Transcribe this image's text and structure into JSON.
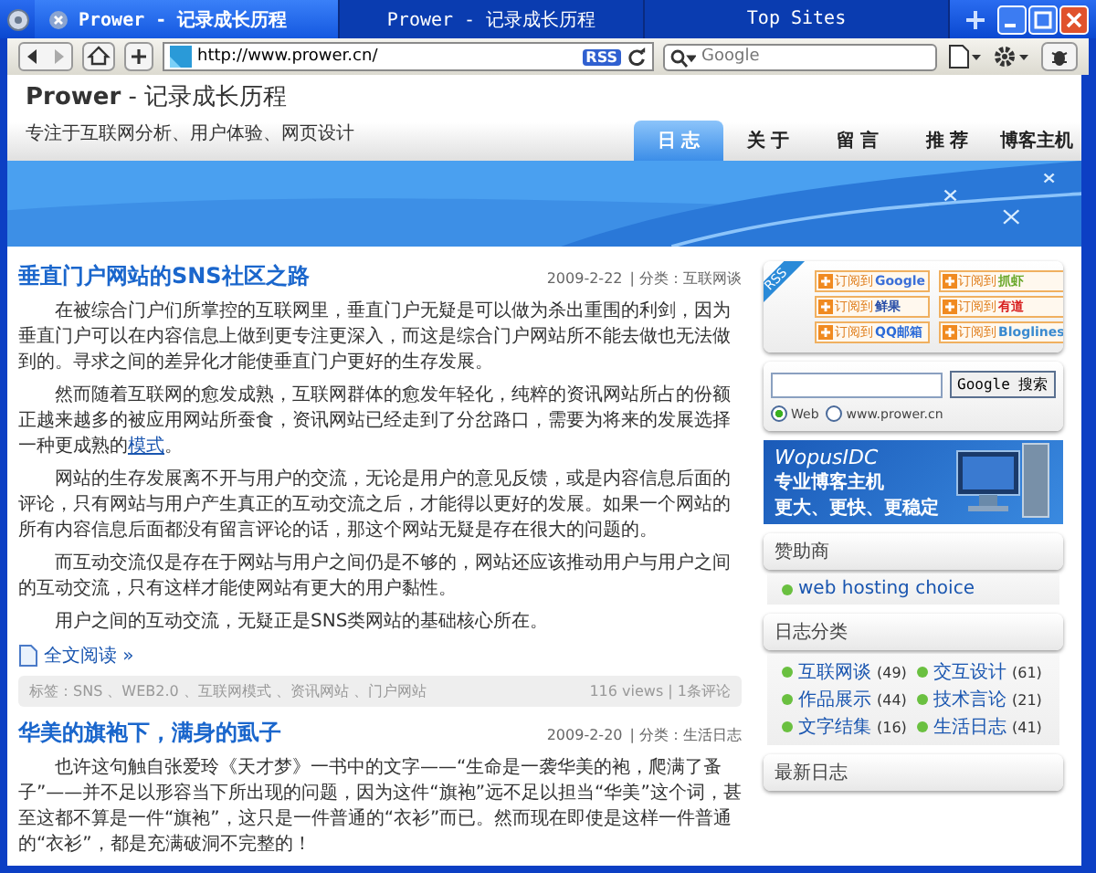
{
  "browser": {
    "tabs": [
      {
        "label": "Prower - 记录成长历程",
        "selected": true
      },
      {
        "label": "Prower - 记录成长历程",
        "selected": false
      },
      {
        "label": "Top Sites",
        "selected": false
      }
    ],
    "address": "http://www.prower.cn/",
    "rss_badge": "RSS",
    "search": {
      "placeholder": "Google"
    }
  },
  "site": {
    "title": "Prower",
    "title_rest": " - 记录成长历程",
    "tagline": "专注于互联网分析、用户体验、网页设计",
    "nav": [
      {
        "label": "日 志",
        "selected": true
      },
      {
        "label": "关 于",
        "selected": false
      },
      {
        "label": "留 言",
        "selected": false
      },
      {
        "label": "推 荐",
        "selected": false
      },
      {
        "label": "博客主机",
        "selected": false
      }
    ]
  },
  "posts": [
    {
      "title": "垂直门户网站的SNS社区之路",
      "date": "2009-2-22",
      "category": "| 分类：互联网谈",
      "paragraphs": [
        {
          "text": "在被综合门户们所掌控的互联网里，垂直门户无疑是可以做为杀出重围的利剑，因为垂直门户可以在内容信息上做到更专注更深入，而这是综合门户网站所不能去做也无法做到的。寻求之间的差异化才能使垂直门户更好的生存发展。"
        },
        {
          "text": "然而随着互联网的愈发成熟，互联网群体的愈发年轻化，纯粹的资讯网站所占的份额正越来越多的被应用网站所蚕食，资讯网站已经走到了分岔路口，需要为将来的发展选择一种更成熟的",
          "link": "模式",
          "after": "。"
        },
        {
          "text": "网站的生存发展离不开与用户的交流，无论是用户的意见反馈，或是内容信息后面的评论，只有网站与用户产生真正的互动交流之后，才能得以更好的发展。如果一个网站的所有内容信息后面都没有留言评论的话，那这个网站无疑是存在很大的问题的。"
        },
        {
          "text": "而互动交流仅是存在于网站与用户之间仍是不够的，网站还应该推动用户与用户之间的互动交流，只有这样才能使网站有更大的用户黏性。"
        },
        {
          "text": "用户之间的互动交流，无疑正是SNS类网站的基础核心所在。"
        }
      ],
      "read_more": "全文阅读 »",
      "tags": "标签：SNS 、WEB2.0 、互联网模式 、资讯网站 、门户网站",
      "stats": "116 views | 1条评论"
    },
    {
      "title": "华美的旗袍下，满身的虱子",
      "date": "2009-2-20",
      "category": "| 分类：生活日志",
      "paragraphs": [
        {
          "text": "也许这句触自张爱玲《天才梦》一书中的文字——“生命是一袭华美的袍，爬满了蚤子”——并不足以形容当下所出现的问题，因为这件“旗袍”远不足以担当“华美”这个词，甚至这都不算是一件“旗袍”，这只是一件普通的“衣衫”而已。然而现在即使是这样一件普通的“衣衫”，都是充满破洞不完整的！"
        }
      ]
    }
  ],
  "sidebar": {
    "rss_ribbon": "RSS",
    "subscribe": [
      {
        "prefix": "订阅到",
        "service": "Google",
        "color": "#3a6fd8"
      },
      {
        "prefix": "订阅到",
        "service": "抓虾",
        "color": "#6aa82c"
      },
      {
        "prefix": "订阅到",
        "service": "鲜果",
        "color": "#2a4fa8"
      },
      {
        "prefix": "订阅到",
        "service": "有道",
        "color": "#d82020"
      },
      {
        "prefix": "订阅到",
        "service": "QQ邮箱",
        "color": "#2a6ad8"
      },
      {
        "prefix": "订阅到",
        "service": "Bloglines",
        "color": "#3a8ad0"
      }
    ],
    "search": {
      "button": "Google 搜索",
      "options": [
        {
          "label": "Web",
          "selected": true
        },
        {
          "label": "www.prower.cn",
          "selected": false
        }
      ]
    },
    "ad": {
      "brand": "WopusIDC",
      "line1": "专业博客主机",
      "line2": "更大、更快、更稳定"
    },
    "sponsors": {
      "title": "赞助商",
      "items": [
        "web hosting choice"
      ]
    },
    "categories": {
      "title": "日志分类",
      "items": [
        {
          "name": "互联网谈",
          "count": "(49)"
        },
        {
          "name": "交互设计",
          "count": "(61)"
        },
        {
          "name": "作品展示",
          "count": "(44)"
        },
        {
          "name": "技术言论",
          "count": "(21)"
        },
        {
          "name": "文字结集",
          "count": "(16)"
        },
        {
          "name": "生活日志",
          "count": "(41)"
        }
      ]
    },
    "recent": {
      "title": "最新日志"
    }
  }
}
